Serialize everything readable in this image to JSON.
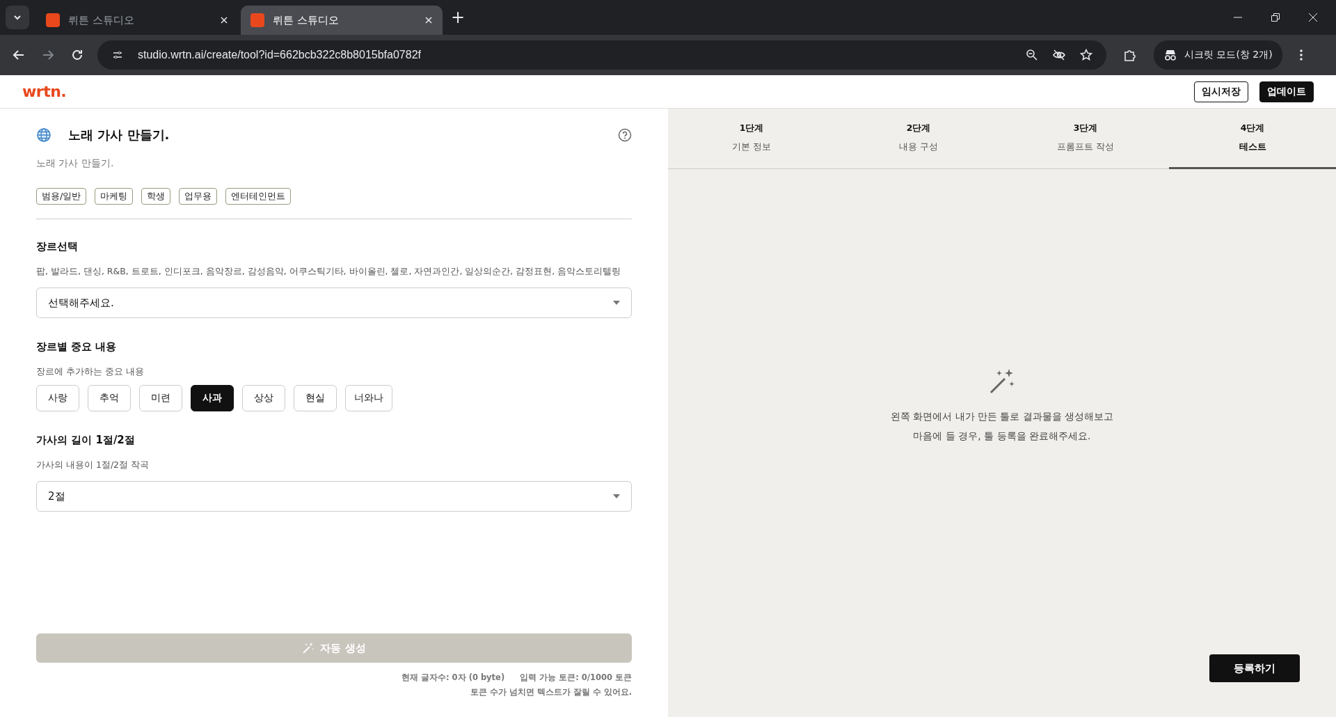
{
  "browser": {
    "tabs": [
      {
        "title": "뤼튼 스튜디오",
        "selected": false
      },
      {
        "title": "뤼튼 스튜디오",
        "selected": true
      }
    ],
    "new_tab": "+",
    "url": "studio.wrtn.ai/create/tool?id=662bcb322c8b8015bfa0782f",
    "incognito": "시크릿 모드(창 2개)"
  },
  "header": {
    "logo": "wrtn.",
    "buttons": [
      {
        "label": "임시저장",
        "kind": "outline"
      },
      {
        "label": "업데이트",
        "kind": "solid"
      }
    ]
  },
  "tool": {
    "title": "노래 가사 만들기.",
    "description": "노래 가사 만들기.",
    "tags": [
      "범용/일반",
      "마케팅",
      "학생",
      "업무용",
      "엔터테인먼트"
    ]
  },
  "fields": [
    {
      "kind": "select",
      "label": "장르선택",
      "hint": "팝, 발라드, 댄싱, R&B, 트로트, 인디포크, 음악장르, 감성음악, 어쿠스틱기타, 바이올린, 첼로, 자연과인간, 일상의순간, 감정표현, 음악스토리텔링",
      "value": "선택해주세요."
    },
    {
      "kind": "chips",
      "label": "장르별 중요 내용",
      "hint": "장르에 추가하는 중요 내용",
      "options": [
        {
          "label": "사랑",
          "selected": false
        },
        {
          "label": "추억",
          "selected": false
        },
        {
          "label": "미련",
          "selected": false
        },
        {
          "label": "사과",
          "selected": true
        },
        {
          "label": "상상",
          "selected": false
        },
        {
          "label": "현실",
          "selected": false
        },
        {
          "label": "너와나",
          "selected": false
        }
      ]
    },
    {
      "kind": "select",
      "label": "가사의 길이 1절/2절",
      "hint": "가사의 내용이 1절/2절 작곡",
      "value": "2절"
    }
  ],
  "generate": {
    "label": "자동 생성",
    "disabled": true
  },
  "stats": {
    "chars": "현재 글자수: 0자 (0 byte)",
    "tokens": "입력 가능 토큰: 0/1000 토큰",
    "warning": "토큰 수가 넘치면 텍스트가 잘릴 수 있어요."
  },
  "steps": [
    {
      "step": "1단계",
      "name": "기본 정보",
      "selected": false
    },
    {
      "step": "2단계",
      "name": "내용 구성",
      "selected": false
    },
    {
      "step": "3단계",
      "name": "프롬프트 작성",
      "selected": false
    },
    {
      "step": "4단계",
      "name": "테스트",
      "selected": true
    }
  ],
  "empty_state": {
    "lines": [
      "왼쪽 화면에서 내가 만든 툴로 결과물을 생성해보고",
      "마음에 들 경우, 툴 등록을 완료해주세요."
    ]
  },
  "register_button": "등록하기"
}
